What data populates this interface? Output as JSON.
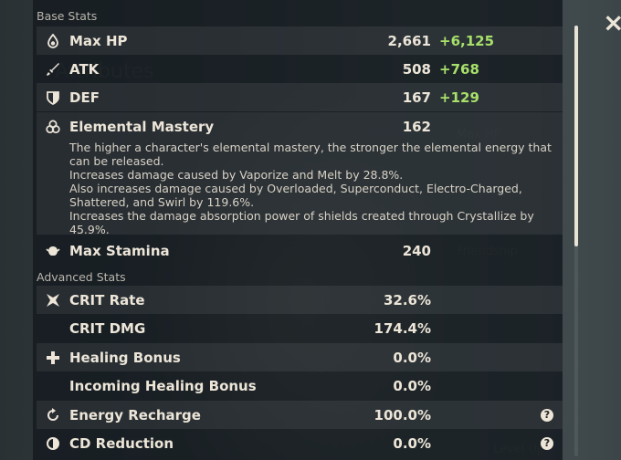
{
  "sections": {
    "base": "Base Stats",
    "advanced": "Advanced Stats"
  },
  "base_stats": [
    {
      "name": "Max HP",
      "value": "2,661",
      "bonus": "+6,125",
      "icon": "hp-droplet-icon"
    },
    {
      "name": "ATK",
      "value": "508",
      "bonus": "+768",
      "icon": "sword-icon"
    },
    {
      "name": "DEF",
      "value": "167",
      "bonus": "+129",
      "icon": "shield-icon"
    },
    {
      "name": "Elemental Mastery",
      "value": "162",
      "icon": "elemental-mastery-icon"
    },
    {
      "name": "Max Stamina",
      "value": "240",
      "icon": "stamina-icon"
    }
  ],
  "elemental_mastery_description": [
    "The higher a character's elemental mastery, the stronger the elemental energy that can be released.",
    "Increases damage caused by Vaporize and Melt by 28.8%.",
    "Also increases damage caused by Overloaded, Superconduct, Electro-Charged, Shattered, and Swirl by 119.6%.",
    "Increases the damage absorption power of shields created through Crystallize by 45.9%."
  ],
  "advanced_stats": [
    {
      "name": "CRIT Rate",
      "value": "32.6%",
      "icon": "crit-star-icon"
    },
    {
      "name": "CRIT DMG",
      "value": "174.4%"
    },
    {
      "name": "Healing Bonus",
      "value": "0.0%",
      "icon": "healing-cross-icon"
    },
    {
      "name": "Incoming Healing Bonus",
      "value": "0.0%"
    },
    {
      "name": "Energy Recharge",
      "value": "100.0%",
      "icon": "energy-recharge-icon",
      "help": "?"
    },
    {
      "name": "CD Reduction",
      "value": "0.0%",
      "icon": "cd-reduction-icon",
      "help": "?"
    }
  ],
  "close_label": "×",
  "colors": {
    "bonus": "#a7e06a",
    "text": "#ece5d8",
    "panel": "#141a1e"
  },
  "scroll_position": 0.0
}
